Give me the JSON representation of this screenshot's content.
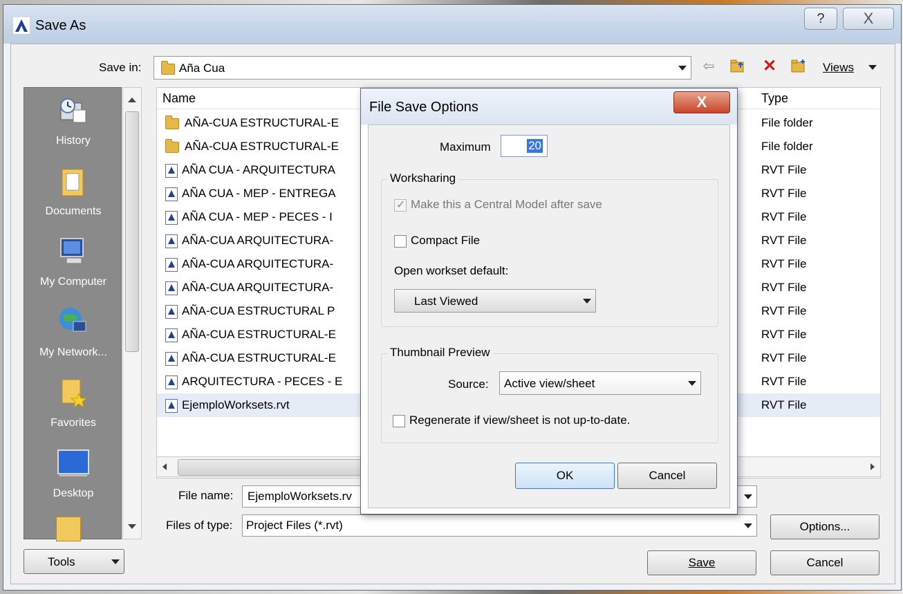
{
  "window": {
    "title": "Save As",
    "help_glyph": "?",
    "close_glyph": "X"
  },
  "toolbar": {
    "save_in_label": "Save in:",
    "save_in_value": "Aña Cua",
    "views_label": "Views",
    "icons": [
      "back-arrow-icon",
      "up-folder-icon",
      "delete-icon",
      "new-folder-icon"
    ]
  },
  "places": [
    {
      "label": "History",
      "icon": "history-icon"
    },
    {
      "label": "Documents",
      "icon": "documents-icon"
    },
    {
      "label": "My Computer",
      "icon": "computer-icon"
    },
    {
      "label": "My Network...",
      "icon": "network-icon"
    },
    {
      "label": "Favorites",
      "icon": "favorites-icon"
    },
    {
      "label": "Desktop",
      "icon": "desktop-icon"
    }
  ],
  "list": {
    "columns": {
      "name": "Name",
      "type": "Type"
    },
    "rows": [
      {
        "name": "AÑA-CUA ESTRUCTURAL-E",
        "type": "File folder",
        "kind": "folder"
      },
      {
        "name": "AÑA-CUA ESTRUCTURAL-E",
        "type": "File folder",
        "kind": "folder"
      },
      {
        "name": "AÑA CUA - ARQUITECTURA",
        "type": "RVT File",
        "kind": "rvt"
      },
      {
        "name": "AÑA CUA - MEP - ENTREGA",
        "type": "RVT File",
        "kind": "rvt"
      },
      {
        "name": "AÑA CUA - MEP - PECES - I",
        "type": "RVT File",
        "kind": "rvt"
      },
      {
        "name": "AÑA-CUA ARQUITECTURA-",
        "type": "RVT File",
        "kind": "rvt"
      },
      {
        "name": "AÑA-CUA ARQUITECTURA-",
        "type": "RVT File",
        "kind": "rvt"
      },
      {
        "name": "AÑA-CUA ARQUITECTURA-",
        "type": "RVT File",
        "kind": "rvt"
      },
      {
        "name": "AÑA-CUA ESTRUCTURAL P",
        "type": "RVT File",
        "kind": "rvt"
      },
      {
        "name": "AÑA-CUA ESTRUCTURAL-E",
        "type": "RVT File",
        "kind": "rvt"
      },
      {
        "name": "AÑA-CUA ESTRUCTURAL-E",
        "type": "RVT File",
        "kind": "rvt"
      },
      {
        "name": "ARQUITECTURA - PECES - E",
        "type": "RVT File",
        "kind": "rvt"
      },
      {
        "name": "EjemploWorksets.rvt",
        "type": "RVT File",
        "kind": "rvt"
      }
    ]
  },
  "bottom": {
    "file_name_label": "File name:",
    "file_name_value": "EjemploWorksets.rv",
    "files_of_type_label": "Files of type:",
    "files_of_type_value": "Project Files  (*.rvt)",
    "options_label": "Options...",
    "tools_label": "Tools",
    "save_label": "Save",
    "cancel_label": "Cancel"
  },
  "modal": {
    "title": "File Save Options",
    "close_glyph": "X",
    "maximum_label": "Maximum",
    "maximum_value": "20",
    "worksharing_title": "Worksharing",
    "central_model_label": "Make this a Central Model after save",
    "central_model_checked": true,
    "compact_label": "Compact File",
    "compact_checked": false,
    "open_workset_label": "Open workset default:",
    "open_workset_value": "Last Viewed",
    "thumbnail_title": "Thumbnail Preview",
    "source_label": "Source:",
    "source_value": "Active view/sheet",
    "regenerate_label": "Regenerate if view/sheet is not up-to-date.",
    "regenerate_checked": false,
    "ok_label": "OK",
    "cancel_label": "Cancel"
  }
}
